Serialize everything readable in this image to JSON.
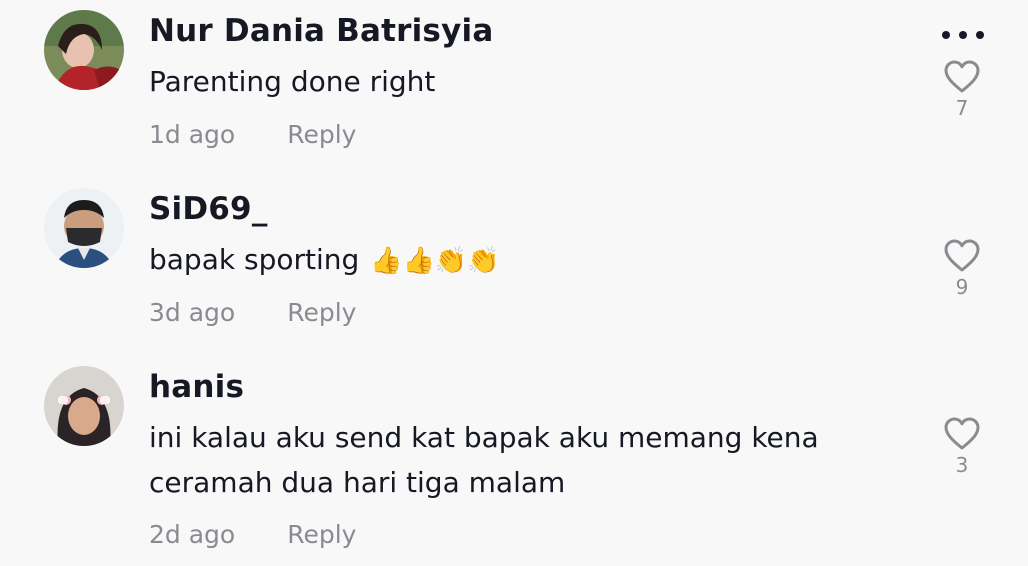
{
  "comments": [
    {
      "username": "Nur Dania Batrisyia",
      "text": "Parenting done right",
      "emojis": "",
      "time": "1d ago",
      "reply_label": "Reply",
      "likes": "7",
      "avatar_icon": "profile-photo-avatar"
    },
    {
      "username": "SiD69_",
      "text": "bapak sporting",
      "emojis": "👍👍👏👏",
      "time": "3d ago",
      "reply_label": "Reply",
      "likes": "9",
      "avatar_icon": "profile-photo-avatar"
    },
    {
      "username": "hanis",
      "text": "ini kalau aku send kat bapak aku memang kena ceramah dua hari tiga malam",
      "emojis": "",
      "time": "2d ago",
      "reply_label": "Reply",
      "likes": "3",
      "avatar_icon": "profile-photo-avatar"
    }
  ],
  "icons": {
    "more": "more-options-icon",
    "like": "heart-outline-icon"
  },
  "colors": {
    "background": "#f8f8f8",
    "username": "#161823",
    "secondary": "#8a8b91"
  }
}
